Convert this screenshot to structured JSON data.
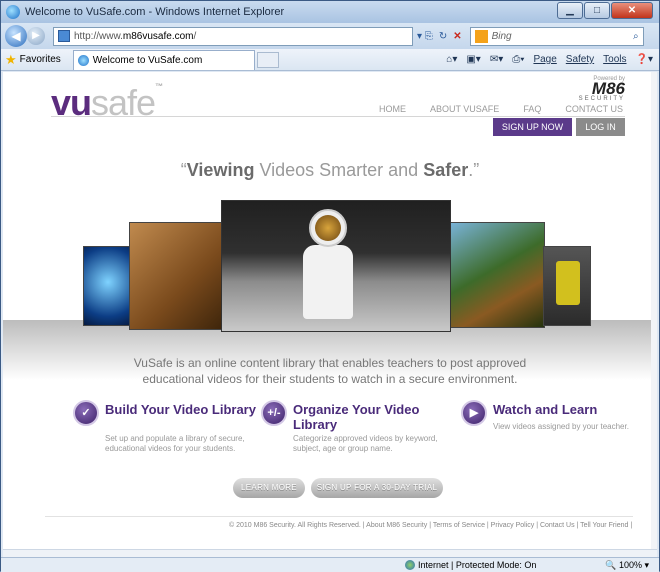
{
  "window": {
    "title": "Welcome to VuSafe.com - Windows Internet Explorer",
    "buttons": {
      "minimize": "▁",
      "maximize": "□",
      "close": "✕"
    }
  },
  "address_bar": {
    "url_prefix": "http://www.",
    "url_domain": "m86vusafe.com",
    "url_suffix": "/",
    "search_placeholder": "Bing"
  },
  "favorites_bar": {
    "favorites_label": "Favorites",
    "tab_title": "Welcome to VuSafe.com",
    "commands": [
      "Page",
      "Safety",
      "Tools"
    ]
  },
  "page": {
    "logo_vu": "vu",
    "logo_safe": "safe",
    "logo_tm": "™",
    "m86_powered": "Powered by",
    "m86_mark": "M86",
    "m86_security": "SECURITY",
    "nav": [
      "HOME",
      "ABOUT VUSAFE",
      "FAQ",
      "CONTACT US"
    ],
    "signup_label": "SIGN UP NOW",
    "login_label": "LOG IN",
    "tagline_q1": "“",
    "tagline_bold1": "Viewing",
    "tagline_mid": " Videos Smarter and ",
    "tagline_bold2": "Safer",
    "tagline_end": ".”",
    "description": "VuSafe is an online content library that enables teachers to post approved educational videos for their students to watch in a secure environment.",
    "features": [
      {
        "title": "Build Your Video Library",
        "desc": "Set up and populate a library of secure, educational videos for your students."
      },
      {
        "title": "Organize Your Video Library",
        "desc": "Categorize approved videos by keyword, subject, age or group name."
      },
      {
        "title": "Watch and Learn",
        "desc": "View videos assigned by your teacher."
      }
    ],
    "learn_more_label": "LEARN MORE",
    "trial_label": "SIGN UP FOR A 30-DAY TRIAL",
    "footer": "© 2010 M86 Security. All Rights Reserved.  |  About M86 Security  | Terms of Service  | Privacy Policy  |  Contact Us  |  Tell Your Friend  |"
  },
  "status_bar": {
    "zone": "Internet | Protected Mode: On",
    "zoom": "100%"
  },
  "colors": {
    "brand_purple": "#5b2c7e",
    "button_purple": "#5b3a8a",
    "button_gray": "#8b8b8b"
  }
}
